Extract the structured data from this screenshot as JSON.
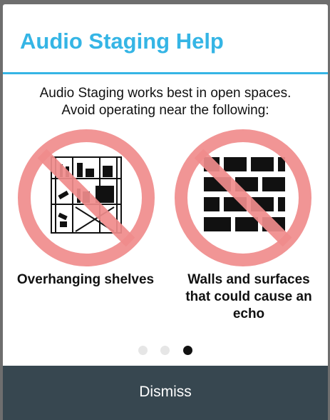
{
  "dialog": {
    "title": "Audio Staging Help",
    "message_line1": "Audio Staging works best in open spaces.",
    "message_line2": "Avoid operating near the following:"
  },
  "items": [
    {
      "caption": "Overhanging shelves",
      "icon": "shelves-prohibited-icon"
    },
    {
      "caption_line1": "Walls and surfaces",
      "caption_line2": "that could cause an",
      "caption_line3": "echo",
      "icon": "brick-wall-prohibited-icon"
    }
  ],
  "pager": {
    "pages": 3,
    "current_page": 3
  },
  "dismiss_label": "Dismiss",
  "colors": {
    "accent": "#35b5e5",
    "prohibition": "#f08c8c",
    "button_bar": "#374750"
  }
}
